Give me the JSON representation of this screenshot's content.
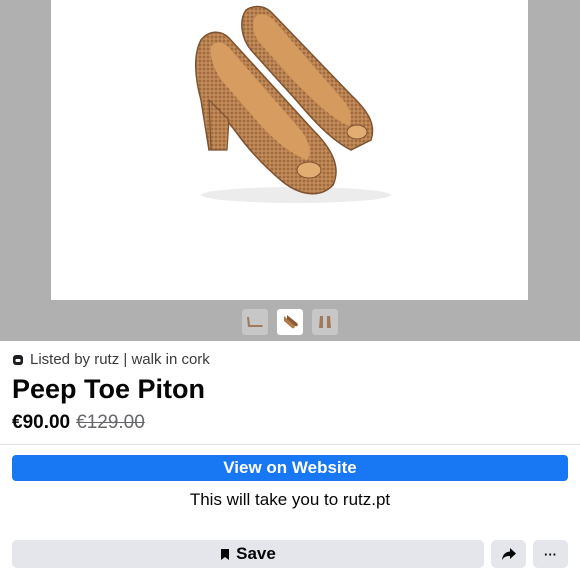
{
  "listing": {
    "listed_by": "Listed by rutz | walk in cork",
    "title": "Peep Toe Piton",
    "price": "€90.00",
    "original_price": "€129.00"
  },
  "gallery": {
    "main_image_icon": "cork-peep-toe-shoes-image",
    "thumbnails": [
      "shoe-side-thumbnail",
      "shoe-pair-thumbnail",
      "shoe-back-thumbnail"
    ],
    "active_thumbnail": 2
  },
  "actions": {
    "view_label": "View on Website",
    "redirect_text": "This will take you to rutz.pt",
    "save_label": "Save",
    "share_icon": "share-arrow-icon",
    "more_label": "···"
  },
  "colors": {
    "brand_blue": "#1877f2",
    "button_grey": "#e4e6eb",
    "gallery_bg": "#b0b0b0",
    "cork": "#b07a4a"
  }
}
